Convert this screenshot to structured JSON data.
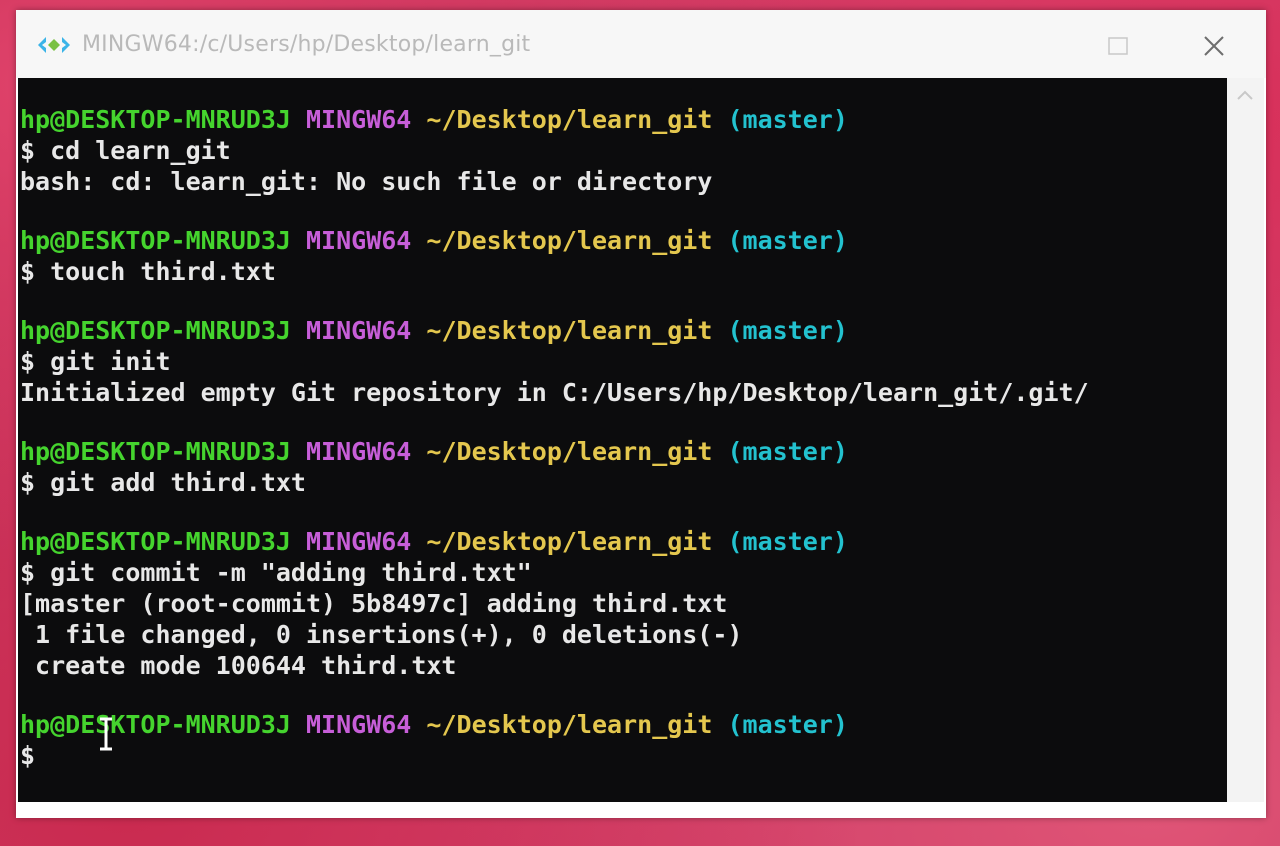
{
  "window": {
    "title": "MINGW64:/c/Users/hp/Desktop/learn_git",
    "colors": {
      "user": "#45d42e",
      "shell": "#c75ed8",
      "path": "#e4c74e",
      "branch": "#23c2cf",
      "background": "#0c0c0d"
    }
  },
  "prompt": {
    "user": "hp@DESKTOP-MNRUD3J",
    "shell": "MINGW64",
    "path": "~/Desktop/learn_git",
    "branch": "(master)"
  },
  "entries": [
    {
      "command": "$ cd learn_git",
      "output": [
        "bash: cd: learn_git: No such file or directory"
      ]
    },
    {
      "command": "$ touch third.txt",
      "output": []
    },
    {
      "command": "$ git init",
      "output": [
        "Initialized empty Git repository in C:/Users/hp/Desktop/learn_git/.git/"
      ]
    },
    {
      "command": "$ git add third.txt",
      "output": []
    },
    {
      "command": "$ git commit -m \"adding third.txt\"",
      "output": [
        "[master (root-commit) 5b8497c] adding third.txt",
        " 1 file changed, 0 insertions(+), 0 deletions(-)",
        " create mode 100644 third.txt"
      ]
    }
  ],
  "current_prompt_symbol": "$",
  "icons": {
    "app": "mingw-icon",
    "maximize": "maximize-icon",
    "close": "close-icon",
    "scroll_up": "chevron-up-icon"
  }
}
